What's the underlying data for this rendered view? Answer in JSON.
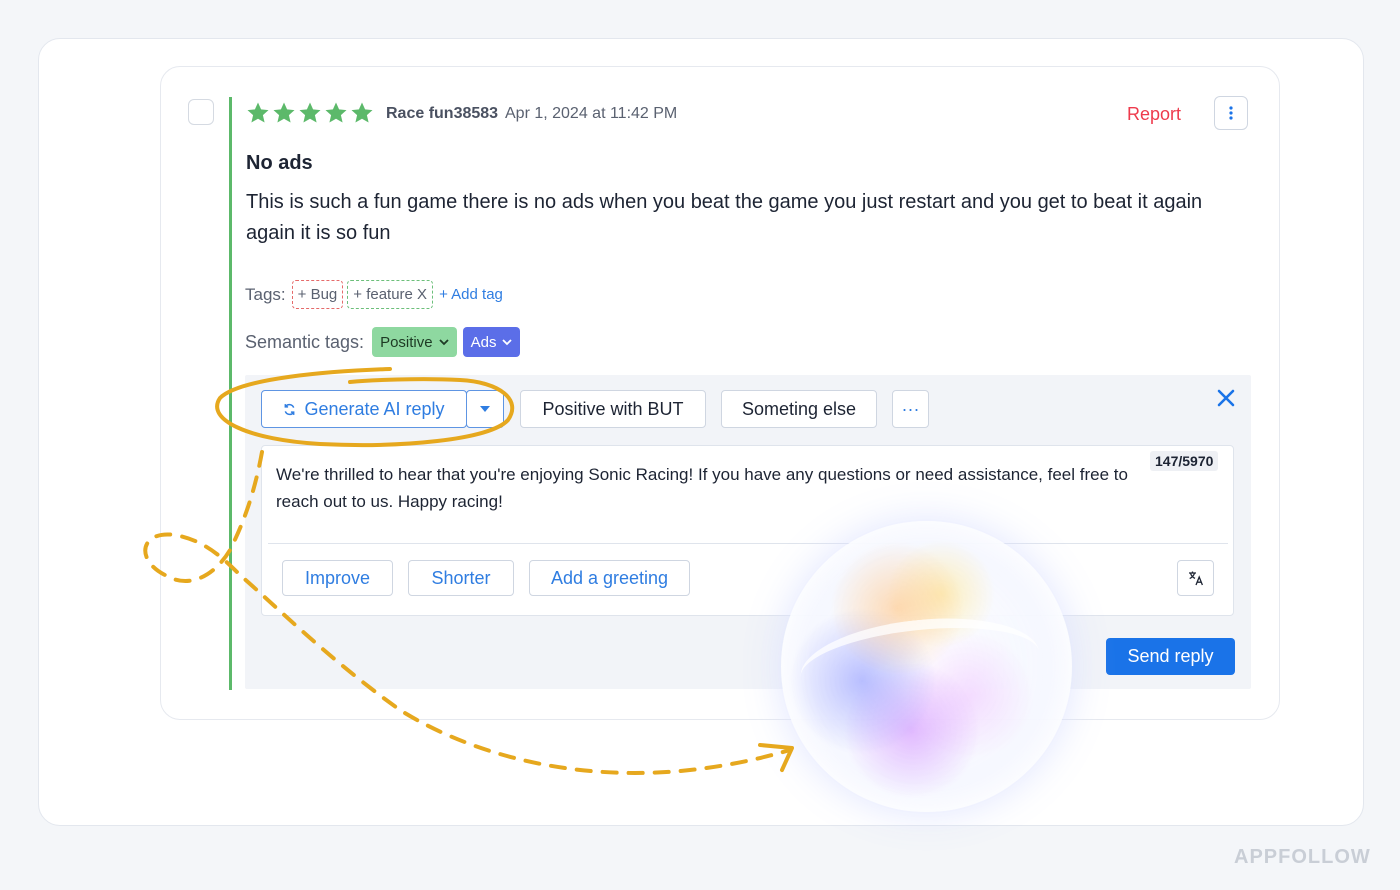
{
  "review": {
    "rating": 5,
    "author": "Race fun38583",
    "date": "Apr 1, 2024 at 11:42 PM",
    "report_label": "Report",
    "more_icon": "vertical-dots-icon",
    "title": "No ads",
    "text": "This is such a fun game there is no ads when you beat the game you just restart and you get to beat it again again it is so fun"
  },
  "tags": {
    "label": "Tags:",
    "items": [
      "+ Bug",
      "+ feature X"
    ],
    "add_label": "+ Add tag"
  },
  "semantic_tags": {
    "label": "Semantic tags:",
    "items": [
      {
        "label": "Positive",
        "color": "#8ed8a0"
      },
      {
        "label": "Ads",
        "color": "#5b6ee8"
      }
    ]
  },
  "reply": {
    "generate_label": "Generate AI reply",
    "templates": [
      "Positive with BUT",
      "Someting else"
    ],
    "more_label": "···",
    "text": "We're thrilled to hear that you're enjoying Sonic Racing! If you have any questions or need assistance, feel free to reach out to us. Happy racing!",
    "char_count": "147/5970",
    "actions": [
      "Improve",
      "Shorter",
      "Add a greeting"
    ],
    "send_label": "Send reply"
  },
  "colors": {
    "accent_blue": "#1a73e8",
    "report_red": "#ee3a4c",
    "star_green": "#5cb96a",
    "annotation_gold": "#e6a81e"
  },
  "watermark": "APPFOLLOW"
}
